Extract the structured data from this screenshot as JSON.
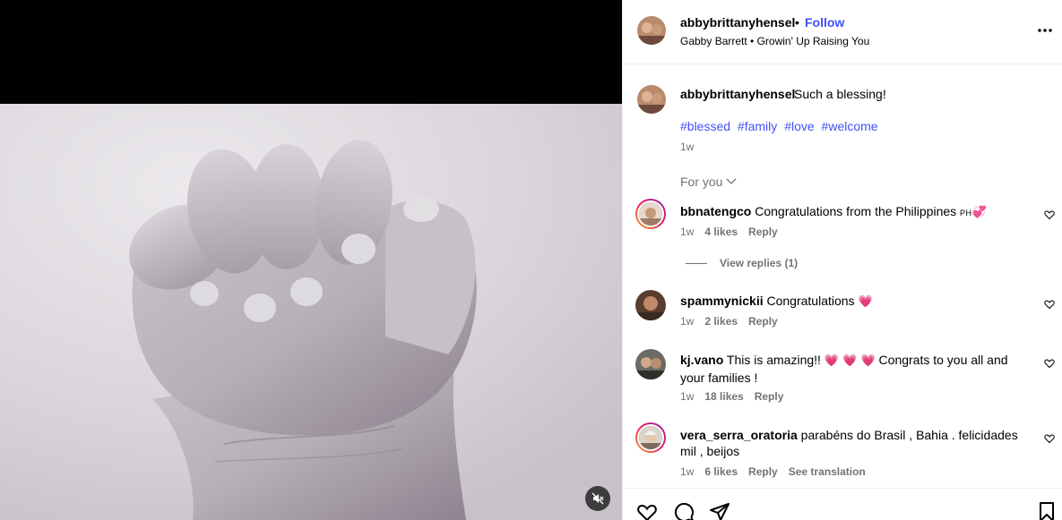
{
  "header": {
    "username": "abbybrittanyhensel",
    "separator": "•",
    "follow_label": "Follow",
    "audio": "Gabby Barrett • Growin' Up Raising You",
    "more_icon": "more-horizontal-icon"
  },
  "caption": {
    "username": "abbybrittanyhensel",
    "text": "Such a blessing!",
    "tags": [
      "#blessed",
      "#family",
      "#love",
      "#welcome"
    ],
    "time": "1w"
  },
  "sort_label": "For you",
  "comments": [
    {
      "username": "bbnatengco",
      "text": "Congratulations from the Philippines",
      "flag": "PH",
      "emoji": "💞",
      "time": "1w",
      "likes": "4 likes",
      "reply": "Reply",
      "view_replies": "View replies (1)"
    },
    {
      "username": "spammynickii",
      "text": "Congratulations",
      "emoji": "💗",
      "time": "1w",
      "likes": "2 likes",
      "reply": "Reply"
    },
    {
      "username": "kj.vano",
      "text_before": "This is amazing!!",
      "emoji": "💗 💗 💗",
      "text_after": "Congrats to you all and your families !",
      "time": "1w",
      "likes": "18 likes",
      "reply": "Reply"
    },
    {
      "username": "vera_serra_oratoria",
      "text": "parabéns do Brasil , Bahia . felicidades mil , beijos",
      "time": "1w",
      "likes": "6 likes",
      "reply": "Reply",
      "translate": "See translation"
    }
  ],
  "colors": {
    "link": "#4150f7",
    "muted": "#737373",
    "border": "#efefef"
  }
}
